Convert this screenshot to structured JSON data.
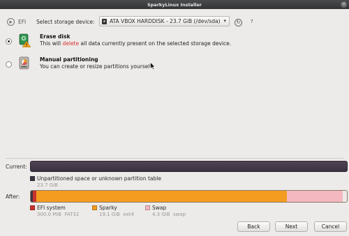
{
  "window": {
    "title": "SparkyLinux Installer",
    "close_glyph": "✕"
  },
  "top": {
    "efi_label": "EFI",
    "efi_icon": "play-circle-icon",
    "storage_label": "Select storage device:",
    "device_value": "ATA VBOX HARDDISK - 23.7 GiB (/dev/sda)",
    "device_icon": "hard-disk-icon",
    "refresh_icon": "refresh-icon",
    "refresh_glyph": "↻",
    "help_glyph": "?"
  },
  "options": [
    {
      "title": "Erase disk",
      "desc_before": "This will ",
      "desc_highlight": "delete",
      "desc_after": " all data currently present on the selected storage device.",
      "selected": true,
      "icon": "erase-disk-warning-icon"
    },
    {
      "title": "Manual partitioning",
      "desc": "You can create or resize partitions yourself.",
      "selected": false,
      "icon": "manual-partition-icon"
    }
  ],
  "current": {
    "label": "Current:",
    "legend": {
      "name": "Unpartitioned space or unknown partition table",
      "size": "23.7 GiB",
      "color": "#3d3442"
    }
  },
  "after": {
    "label": "After:",
    "segments": [
      {
        "name": "EFI system",
        "size": "300.0 MiB",
        "fs": "FAT32",
        "color": "#c8332d",
        "fraction": 0.0124
      },
      {
        "name": "Sparky",
        "size": "19.1 GiB",
        "fs": "ext4",
        "color": "#f39c1f",
        "fraction": 0.806
      },
      {
        "name": "Swap",
        "size": "4.3 GiB",
        "fs": "swap",
        "color": "#f4b8c0",
        "fraction": 0.1816
      }
    ],
    "leading_color": "#3d3442"
  },
  "buttons": {
    "back": "Back",
    "next": "Next",
    "cancel": "Cancel"
  }
}
